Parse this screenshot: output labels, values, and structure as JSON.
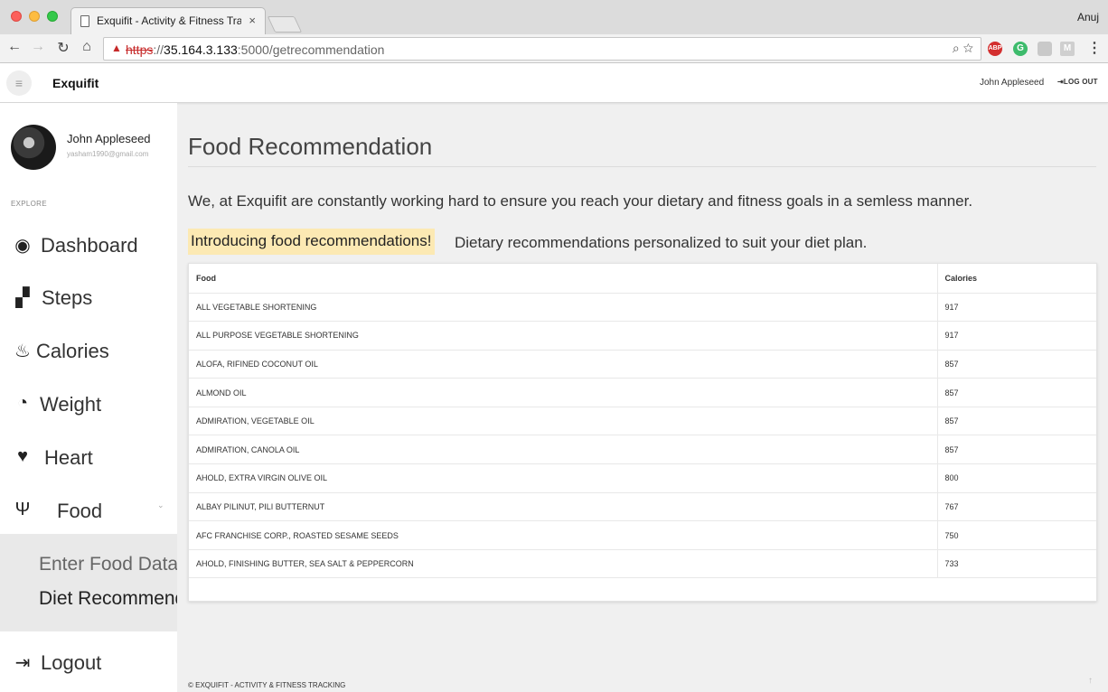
{
  "browser": {
    "tab_title": "Exquifit - Activity & Fitness Tra",
    "tab_close": "×",
    "profile_name": "Anuj",
    "url_scheme": "https",
    "url_sep": "://",
    "url_host": "35.164.3.133",
    "url_path": ":5000/getrecommendation",
    "ext_abp": "ABP",
    "ext_g": "G",
    "ext_m": "M"
  },
  "header": {
    "brand": "Exquifit",
    "user_name": "John Appleseed",
    "logout_label": "LOG OUT"
  },
  "sidebar": {
    "user_name": "John Appleseed",
    "user_email": "yasham1990@gmail.com",
    "section_label": "EXPLORE",
    "items": [
      {
        "label": "Dashboard",
        "icon": "tachometer-icon"
      },
      {
        "label": "Steps",
        "icon": "road-icon"
      },
      {
        "label": "Calories",
        "icon": "fire-icon"
      },
      {
        "label": "Weight",
        "icon": "gauge-icon"
      },
      {
        "label": "Heart",
        "icon": "heart-icon"
      },
      {
        "label": "Food",
        "icon": "cutlery-icon"
      }
    ],
    "submenu": [
      {
        "label": "Enter Food Data"
      },
      {
        "label": "Diet Recommendation"
      }
    ],
    "logout": {
      "label": "Logout",
      "icon": "sign-out-icon"
    }
  },
  "main": {
    "title": "Food Recommendation",
    "intro": "We, at Exquifit are constantly working hard to ensure you reach your dietary and fitness goals in a semless manner.",
    "highlight": "Introducing food recommendations!",
    "highlight_desc": "Dietary recommendations personalized to suit your diet plan.",
    "table": {
      "headers": [
        "Food",
        "Calories"
      ],
      "rows": [
        [
          "ALL VEGETABLE SHORTENING",
          "917"
        ],
        [
          "ALL PURPOSE VEGETABLE SHORTENING",
          "917"
        ],
        [
          "ALOFA, RIFINED COCONUT OIL",
          "857"
        ],
        [
          "ALMOND OIL",
          "857"
        ],
        [
          "ADMIRATION, VEGETABLE OIL",
          "857"
        ],
        [
          "ADMIRATION, CANOLA OIL",
          "857"
        ],
        [
          "AHOLD, EXTRA VIRGIN OLIVE OIL",
          "800"
        ],
        [
          "ALBAY PILINUT, PILI BUTTERNUT",
          "767"
        ],
        [
          "AFC FRANCHISE CORP., ROASTED SESAME SEEDS",
          "750"
        ],
        [
          "AHOLD, FINISHING BUTTER, SEA SALT & PEPPERCORN",
          "733"
        ]
      ]
    },
    "footer": "© EXQUIFIT - ACTIVITY & FITNESS TRACKING"
  },
  "colors": {
    "highlight_bg": "#fce9b3",
    "submenu_bg": "#e9e9e9",
    "content_bg": "#f0f0f0",
    "url_warning": "#c62828"
  }
}
